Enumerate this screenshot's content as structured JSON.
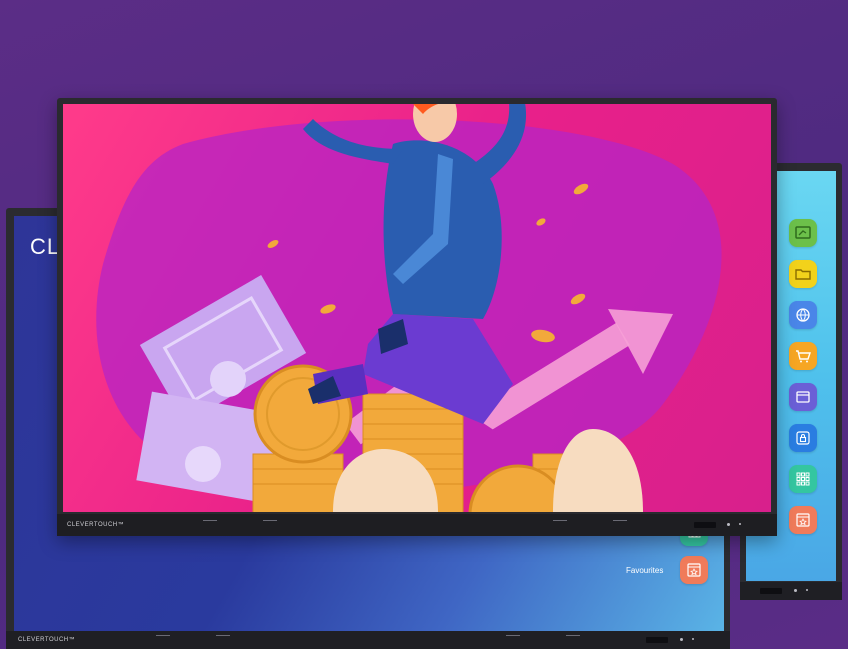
{
  "back_left": {
    "title": "CLI",
    "brand": "CLEVERTOUCH™"
  },
  "back_right": {
    "favourites_label": "Favourites",
    "apps": [
      {
        "name": "whiteboard-icon",
        "color": "#6cc04a"
      },
      {
        "name": "folder-icon",
        "color": "#f2d21b"
      },
      {
        "name": "browser-icon",
        "color": "#4a86e8"
      },
      {
        "name": "shop-icon",
        "color": "#f6a623"
      },
      {
        "name": "window-icon",
        "color": "#6b5fd6"
      },
      {
        "name": "lock-icon",
        "color": "#2a7de1"
      },
      {
        "name": "apps-grid-icon",
        "color": "#34c6a0"
      },
      {
        "name": "favourites-icon",
        "color": "#f07b5a"
      }
    ]
  },
  "front": {
    "brand": "CLEVERTOUCH™"
  },
  "colors": {
    "background": "#542b83",
    "scene_pink": "#e8208a",
    "suit": "#2a5db0",
    "coins": "#f2a93b",
    "arrow": "#f6a0d6"
  }
}
